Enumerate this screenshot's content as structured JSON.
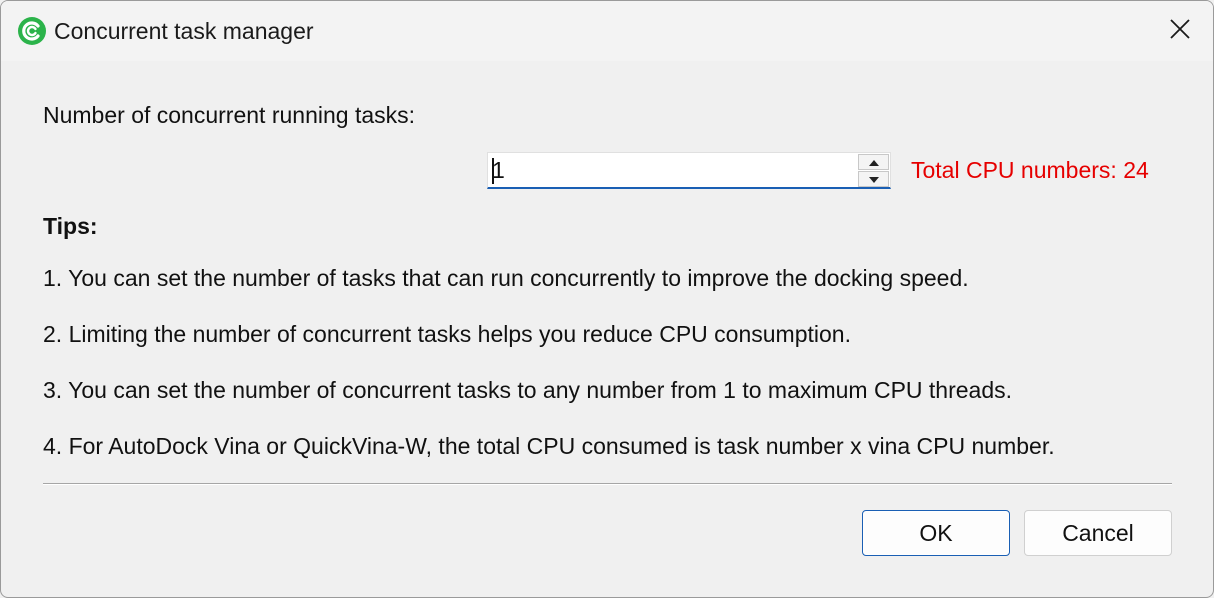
{
  "window": {
    "title": "Concurrent task manager"
  },
  "form": {
    "label": "Number of concurrent running tasks:",
    "task_count": "1",
    "cpu_total": "Total CPU numbers: 24",
    "cpu_total_color": "#e60000"
  },
  "tips": {
    "heading": "Tips:",
    "items": [
      "1. You can set the number of tasks that can run concurrently to improve the docking speed.",
      "2. Limiting the number of concurrent tasks helps you reduce CPU consumption.",
      "3. You can set the number of concurrent tasks to any number from 1 to maximum CPU threads.",
      "4. For AutoDock Vina or QuickVina-W, the total CPU consumed is task number x vina CPU number."
    ]
  },
  "buttons": {
    "ok": "OK",
    "cancel": "Cancel"
  },
  "icons": {
    "app": "app-logo-icon",
    "close": "close-icon",
    "spin_up": "chevron-up-icon",
    "spin_down": "chevron-down-icon"
  },
  "colors": {
    "accent": "#1a5fb4",
    "app_icon_green": "#2bb34a"
  }
}
